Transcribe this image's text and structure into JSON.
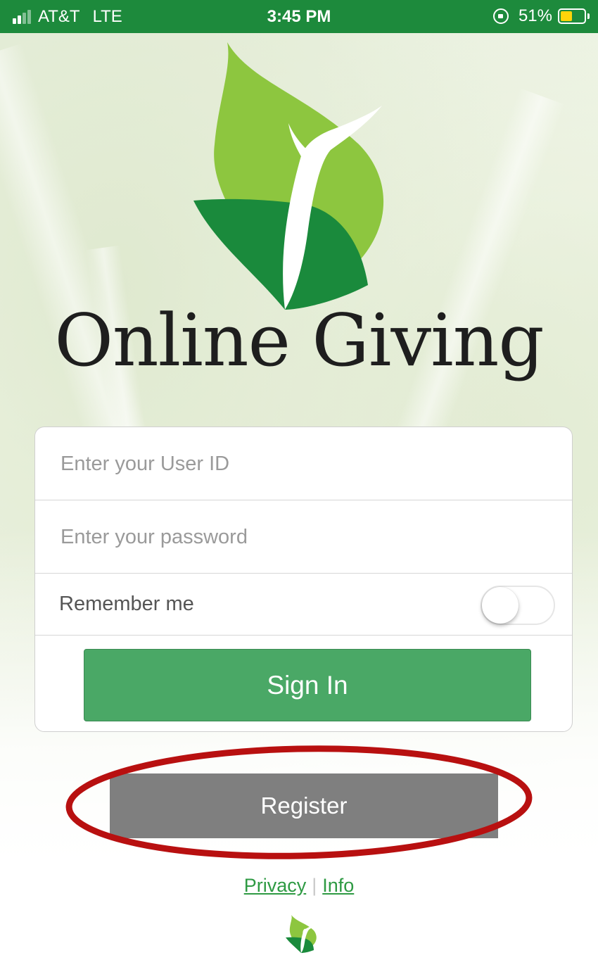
{
  "status_bar": {
    "carrier": "AT&T",
    "network": "LTE",
    "time": "3:45 PM",
    "battery_percent": "51%",
    "battery_level": 0.51,
    "signal_bars": 2,
    "icons": [
      "signal-icon",
      "orientation-lock-icon",
      "battery-icon"
    ]
  },
  "brand": {
    "title": "Online Giving",
    "logo": "leaf-person-logo"
  },
  "login_form": {
    "user_id_placeholder": "Enter your User ID",
    "password_placeholder": "Enter your password",
    "remember_label": "Remember me",
    "remember_on": false,
    "sign_in_label": "Sign In"
  },
  "register": {
    "label": "Register",
    "highlight_color": "#b81010"
  },
  "footer": {
    "privacy_label": "Privacy",
    "separator": "|",
    "info_label": "Info"
  },
  "colors": {
    "status_bar": "#1d8a3c",
    "sign_in": "#4aa866",
    "register": "#7f7f7f",
    "link": "#2e9a43",
    "battery": "#ffd40a"
  }
}
